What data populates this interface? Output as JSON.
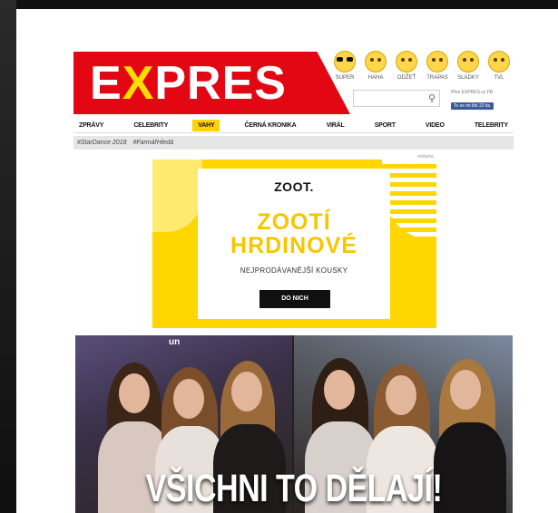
{
  "logo": {
    "pre": "E",
    "x": "X",
    "post": "PRES"
  },
  "reactions": [
    {
      "label": "SUPER",
      "icon": "cool-face-icon"
    },
    {
      "label": "HAHA",
      "icon": "laughing-face-icon"
    },
    {
      "label": "ODŽEŤ",
      "icon": "surprised-face-icon"
    },
    {
      "label": "TRAPAS",
      "icon": "embarrassed-face-icon"
    },
    {
      "label": "SLADKY",
      "icon": "smiling-face-icon"
    },
    {
      "label": "TVL",
      "icon": "grimacing-face-icon"
    }
  ],
  "search": {
    "placeholder": ""
  },
  "facebook": {
    "line1": "Přes EXPRES.cz FB",
    "button": "To se mi líbí 22 tis."
  },
  "nav": [
    {
      "label": "ZPRÁVY",
      "active": false
    },
    {
      "label": "CELEBRITY",
      "active": false
    },
    {
      "label": "VAHY",
      "active": true
    },
    {
      "label": "ČERNÁ KRONIKA",
      "active": false
    },
    {
      "label": "VIRÁL",
      "active": false
    },
    {
      "label": "SPORT",
      "active": false
    },
    {
      "label": "VIDEO",
      "active": false
    },
    {
      "label": "TELEBRITY",
      "active": false
    }
  ],
  "tags": [
    "#StarDance 2018",
    "#FarmářHledá"
  ],
  "ad": {
    "label": "reklama",
    "brand": "ZOOT.",
    "headline_line1": "ZOOTÍ",
    "headline_line2": "HRDINOVÉ",
    "subline": "NEJPRODÁVANĚJŠÍ KOUSKY",
    "cta": "DO NICH"
  },
  "hero": {
    "watermark": "un",
    "title": "VŠICHNI TO DĚLAJÍ!"
  },
  "colors": {
    "brand_red": "#e30613",
    "brand_yellow": "#ffdd00",
    "ad_yellow": "#ffd600"
  }
}
